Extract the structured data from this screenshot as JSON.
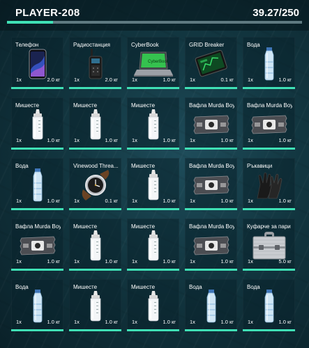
{
  "header": {
    "player_name": "PLAYER-208",
    "weight_text": "39.27/250",
    "weight_fraction": 0.157
  },
  "colors": {
    "accent": "#3fe0b5",
    "bar_track": "#5e7980"
  },
  "items": [
    {
      "name": "Телефон",
      "qty": "1x",
      "weight": "2.0 кг",
      "icon": "phone-icon"
    },
    {
      "name": "Радиостанция",
      "qty": "1x",
      "weight": "2.0 кг",
      "icon": "radio-icon"
    },
    {
      "name": "CyberBook",
      "qty": "1x",
      "weight": "1.0 кг",
      "icon": "laptop-icon"
    },
    {
      "name": "GRID Breaker",
      "qty": "1x",
      "weight": "0.1 кг",
      "icon": "tablet-icon"
    },
    {
      "name": "Вода",
      "qty": "1x",
      "weight": "1.0 кг",
      "icon": "water-bottle-icon"
    },
    {
      "name": "Мишесте",
      "qty": "1x",
      "weight": "1.0 кг",
      "icon": "baby-bottle-icon"
    },
    {
      "name": "Мишесте",
      "qty": "1x",
      "weight": "1.0 кг",
      "icon": "baby-bottle-icon"
    },
    {
      "name": "Мишесте",
      "qty": "1x",
      "weight": "1.0 кг",
      "icon": "baby-bottle-icon"
    },
    {
      "name": "Вафла Murda Boyz",
      "qty": "1x",
      "weight": "1.0 кг",
      "icon": "wafer-icon"
    },
    {
      "name": "Вафла Murda Boyz",
      "qty": "1x",
      "weight": "1.0 кг",
      "icon": "wafer-icon"
    },
    {
      "name": "Вода",
      "qty": "1x",
      "weight": "1.0 кг",
      "icon": "water-bottle-icon"
    },
    {
      "name": "Vinewood Threa...",
      "qty": "1x",
      "weight": "0.1 кг",
      "icon": "watch-icon"
    },
    {
      "name": "Мишесте",
      "qty": "1x",
      "weight": "1.0 кг",
      "icon": "baby-bottle-icon"
    },
    {
      "name": "Вафла Murda Boyz",
      "qty": "1x",
      "weight": "1.0 кг",
      "icon": "wafer-icon"
    },
    {
      "name": "Ръкавици",
      "qty": "1x",
      "weight": "1.0 кг",
      "icon": "gloves-icon"
    },
    {
      "name": "Вафла Murda Boyz",
      "qty": "1x",
      "weight": "1.0 кг",
      "icon": "wafer-icon"
    },
    {
      "name": "Мишесте",
      "qty": "1x",
      "weight": "1.0 кг",
      "icon": "baby-bottle-icon"
    },
    {
      "name": "Мишесте",
      "qty": "1x",
      "weight": "1.0 кг",
      "icon": "baby-bottle-icon"
    },
    {
      "name": "Вафла Murda Boyz",
      "qty": "1x",
      "weight": "1.0 кг",
      "icon": "wafer-icon"
    },
    {
      "name": "Куфарче за пари",
      "qty": "1x",
      "weight": "5.0 кг",
      "icon": "briefcase-icon"
    },
    {
      "name": "Вода",
      "qty": "1x",
      "weight": "1.0 кг",
      "icon": "water-bottle-icon"
    },
    {
      "name": "Мишесте",
      "qty": "1x",
      "weight": "1.0 кг",
      "icon": "baby-bottle-icon"
    },
    {
      "name": "Мишесте",
      "qty": "1x",
      "weight": "1.0 кг",
      "icon": "baby-bottle-icon"
    },
    {
      "name": "Вода",
      "qty": "1x",
      "weight": "1.0 кг",
      "icon": "water-bottle-icon"
    },
    {
      "name": "Вода",
      "qty": "1x",
      "weight": "1.0 кг",
      "icon": "water-bottle-icon"
    }
  ]
}
